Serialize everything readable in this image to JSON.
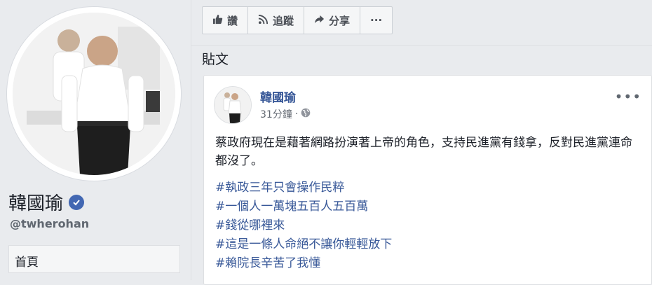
{
  "profile": {
    "name": "韓國瑜",
    "handle": "@twherohan",
    "nav_home": "首頁"
  },
  "actions": [
    {
      "label": "讚",
      "icon": "thumbs-up-icon"
    },
    {
      "label": "追蹤",
      "icon": "rss-follow-icon"
    },
    {
      "label": "分享",
      "icon": "share-arrow-icon"
    },
    {
      "label": "···",
      "icon": "more-icon"
    }
  ],
  "section_title": "貼文",
  "post": {
    "author": "韓國瑜",
    "time": "31分鐘",
    "dot": "·",
    "body": "蔡政府現在是藉著網路扮演著上帝的角色，支持民進黨有錢拿，反對民進黨連命都沒了。",
    "hashtags": [
      "#執政三年只會操作民粹",
      "#一個人一萬塊五百人五百萬",
      "#錢從哪裡來",
      "#這是一條人命絕不讓你輕輕放下",
      "#賴院長辛苦了我懂"
    ],
    "more": "•••"
  },
  "colors": {
    "link": "#385898",
    "verified": "#4267b2",
    "background": "#e9ebee"
  }
}
